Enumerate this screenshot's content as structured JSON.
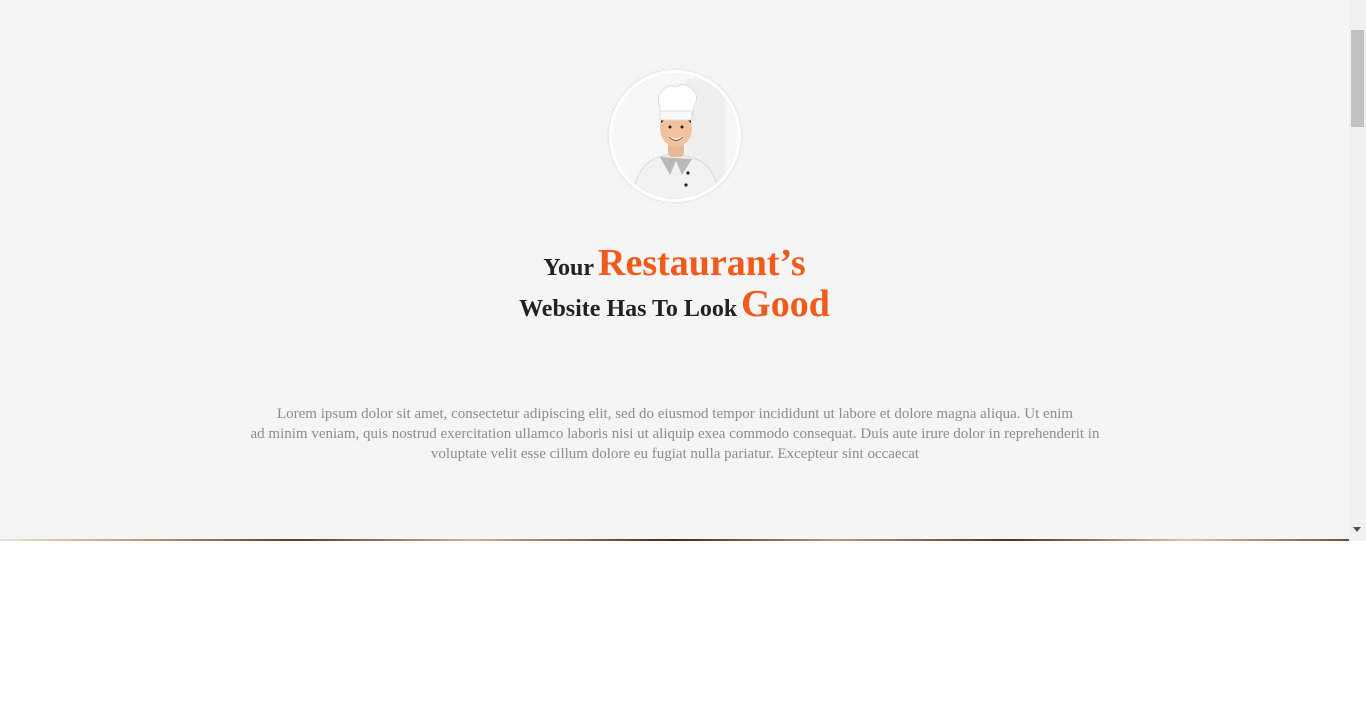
{
  "hero": {
    "avatar_icon": "chef-portrait",
    "headline": {
      "line1_prefix": "Your",
      "line1_highlight": "Restaurant’s",
      "line2_prefix": "Website Has To Look",
      "line2_highlight": "Good"
    },
    "body_lines": [
      "Lorem ipsum dolor sit amet, consectetur adipiscing elit, sed do eiusmod tempor incididunt ut labore et dolore magna aliqua. Ut enim",
      "ad minim veniam, quis nostrud exercitation ullamco laboris nisi ut aliquip exea commodo consequat. Duis aute irure dolor in reprehenderit in",
      "voluptate velit esse cillum dolore eu fugiat nulla pariatur. Excepteur sint occaecat"
    ]
  },
  "colors": {
    "background": "#f5f5f5",
    "accent": "#f05a1a",
    "heading": "#222222",
    "body_text": "#8c8c8c"
  }
}
